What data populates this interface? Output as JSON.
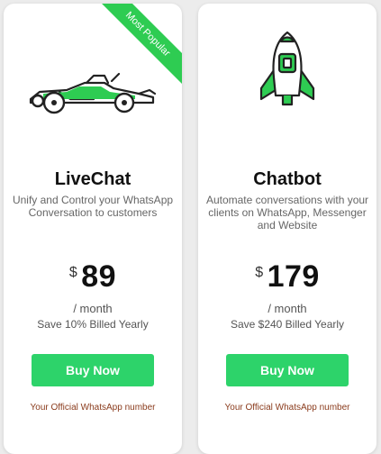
{
  "colors": {
    "accent": "#2ecc52",
    "button": "#2dd36a",
    "note": "#8a3b1c"
  },
  "plans": [
    {
      "badge": "Most Popular",
      "icon": "race-car-icon",
      "title": "LiveChat",
      "description": "Unify and Control your WhatsApp Conversation to customers",
      "currency": "$",
      "price": "89",
      "period": "/ month",
      "save": "Save 10% Billed Yearly",
      "button": "Buy Now",
      "note": "Your Official WhatsApp number"
    },
    {
      "icon": "rocket-icon",
      "title": "Chatbot",
      "description": "Automate conversations with your clients on WhatsApp, Messenger and Website",
      "currency": "$",
      "price": "179",
      "period": "/ month",
      "save": "Save $240 Billed Yearly",
      "button": "Buy Now",
      "note": "Your Official WhatsApp number"
    }
  ]
}
